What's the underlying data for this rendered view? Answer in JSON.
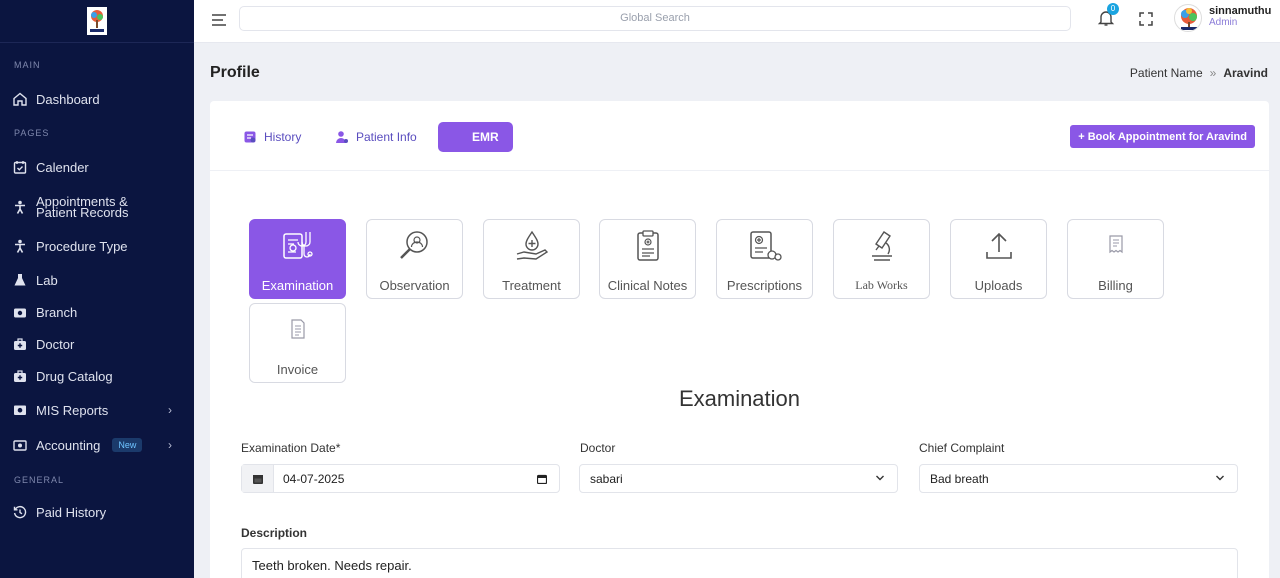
{
  "sidebar": {
    "sections": {
      "main": "MAIN",
      "pages": "PAGES",
      "general": "GENERAL"
    },
    "items": [
      {
        "label": "Dashboard",
        "icon": "home-icon"
      },
      {
        "label": "Calender",
        "icon": "calendar-check-icon"
      },
      {
        "label": "Appointments &",
        "label2": "Patient Records",
        "icon": "person-icon"
      },
      {
        "label": "Procedure Type",
        "icon": "person-icon"
      },
      {
        "label": "Lab",
        "icon": "flask-icon"
      },
      {
        "label": "Branch",
        "icon": "camera-icon"
      },
      {
        "label": "Doctor",
        "icon": "briefcase-medical-icon"
      },
      {
        "label": "Drug Catalog",
        "icon": "briefcase-medical-icon"
      },
      {
        "label": "MIS Reports",
        "icon": "report-icon"
      },
      {
        "label": "Accounting",
        "icon": "money-icon",
        "badge": "New"
      },
      {
        "label": "Paid History",
        "icon": "history-icon"
      }
    ]
  },
  "topbar": {
    "search_placeholder": "Global Search",
    "notification_count": "0",
    "user_name": "sinnamuthu",
    "user_role": "Admin"
  },
  "page": {
    "title": "Profile",
    "breadcrumb_parent": "Patient Name",
    "breadcrumb_sep": "»",
    "breadcrumb_current": "Aravind"
  },
  "tabs": [
    {
      "label": "History"
    },
    {
      "label": "Patient Info"
    },
    {
      "label": "EMR",
      "active": true
    }
  ],
  "book_button": "+ Book Appointment for Aravind",
  "modules": [
    {
      "label": "Examination",
      "active": true
    },
    {
      "label": "Observation"
    },
    {
      "label": "Treatment"
    },
    {
      "label": "Clinical Notes"
    },
    {
      "label": "Prescriptions"
    },
    {
      "label": "Lab Works"
    },
    {
      "label": "Uploads"
    },
    {
      "label": "Billing"
    },
    {
      "label": "Invoice"
    }
  ],
  "section_title": "Examination",
  "form": {
    "date_label": "Examination Date*",
    "date_value": "04-07-2025",
    "doctor_label": "Doctor",
    "doctor_value": "sabari",
    "complaint_label": "Chief Complaint",
    "complaint_value": "Bad breath",
    "description_label": "Description",
    "description_value": "Teeth broken. Needs repair."
  },
  "colors": {
    "sidebar_bg": "#0b1540",
    "accent": "#8a57e6",
    "badge": "#1aa4e0"
  }
}
